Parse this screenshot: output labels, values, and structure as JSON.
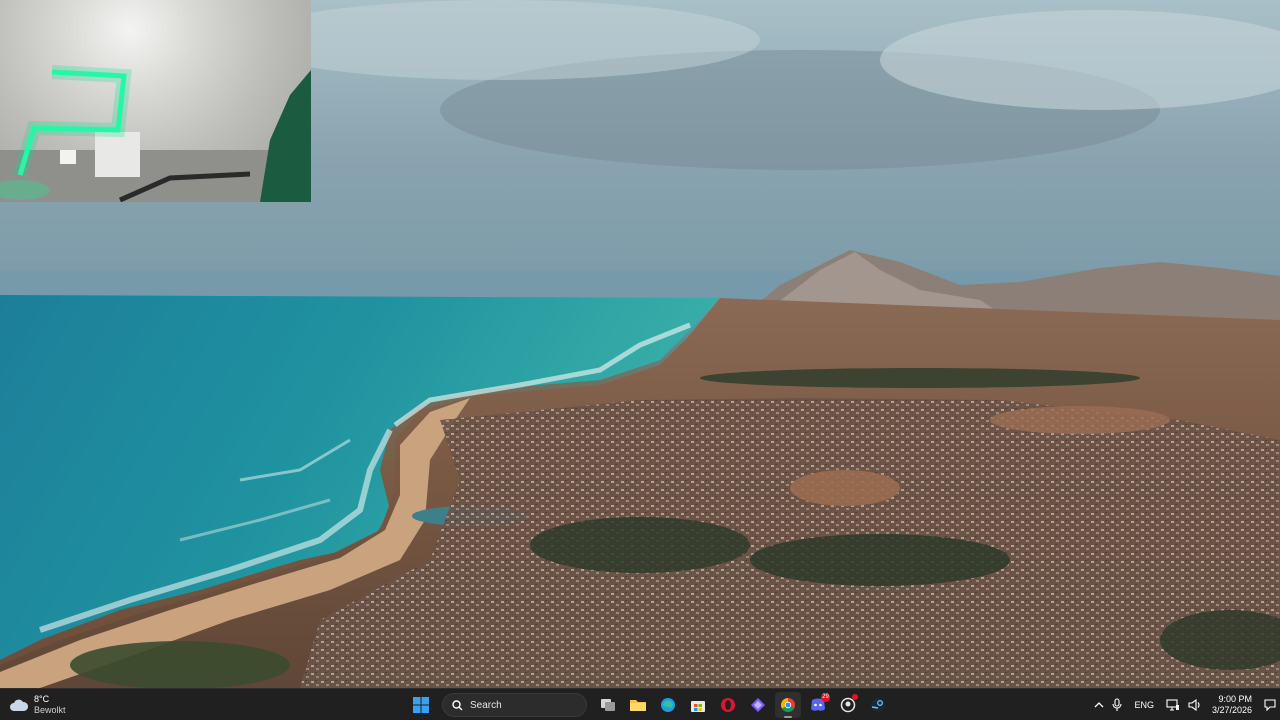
{
  "desktop": {
    "wallpaper": "aerial-coastline-wallpaper"
  },
  "webcam": {
    "icon": "webcam-overlay"
  },
  "taskbar": {
    "weather": {
      "temperature": "8°C",
      "condition": "Bewolkt",
      "icon": "cloud-icon"
    },
    "search": {
      "label": "Search",
      "icon": "search-icon"
    },
    "apps": [
      {
        "name": "start",
        "icon": "windows-start-icon"
      },
      {
        "name": "task-view",
        "icon": "task-view-icon"
      },
      {
        "name": "file-explorer",
        "icon": "folder-icon"
      },
      {
        "name": "edge",
        "icon": "edge-icon"
      },
      {
        "name": "store",
        "icon": "store-icon"
      },
      {
        "name": "opera",
        "icon": "opera-icon"
      },
      {
        "name": "app-purple",
        "icon": "purple-app-icon"
      },
      {
        "name": "chrome",
        "icon": "chrome-icon",
        "active": true
      },
      {
        "name": "discord",
        "icon": "discord-icon",
        "badge": "29"
      },
      {
        "name": "github-desktop",
        "icon": "github-icon"
      },
      {
        "name": "steam",
        "icon": "steam-icon"
      }
    ],
    "tray": {
      "language": "ENG",
      "time": "9:00 PM",
      "date": "3/27/2026"
    },
    "colors": {
      "bar": "#202020",
      "accent": "#0078d4",
      "badge": "#e81123"
    }
  }
}
